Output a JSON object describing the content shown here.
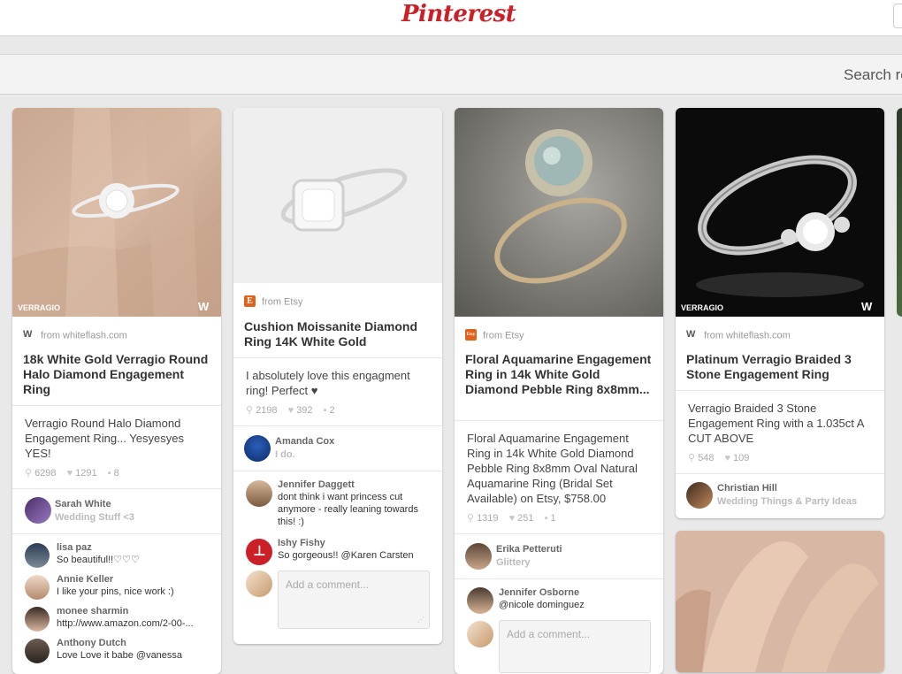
{
  "header": {
    "logo": "Pinterest",
    "search_label": "Search re"
  },
  "colors": {
    "brand": "#cb2027",
    "etsy": "#e1621b"
  },
  "pins": [
    {
      "source_icon": "whiteflash-icon",
      "source": "from whiteflash.com",
      "title": "18k White Gold Verragio Round Halo Diamond Engagement Ring",
      "image_brand": "VERRAGIO",
      "description": "Verragio Round Halo Diamond Engagement Ring... Yesyesyes YES!",
      "repins": "6298",
      "likes": "1291",
      "comments": "8",
      "pinner": "Sarah White",
      "board": "Wedding Stuff <3",
      "comment_list": [
        {
          "name": "lisa paz",
          "text": "So beautiful!!♡♡♡"
        },
        {
          "name": "Annie Keller",
          "text": "I like your pins, nice work :)"
        },
        {
          "name": "monee sharmin",
          "text": "http://www.amazon.com/2-00-..."
        },
        {
          "name": "Anthony Dutch",
          "text": "Love Love it babe @vanessa"
        }
      ]
    },
    {
      "source_icon": "etsy-icon",
      "source_letter": "E",
      "source": "from Etsy",
      "title": "Cushion Moissanite Diamond Ring 14K White Gold",
      "description": "I absolutely love this engagment ring! Perfect ♥",
      "repins": "2198",
      "likes": "392",
      "comments": "2",
      "pinner": "Amanda Cox",
      "board": "I do.",
      "comment_list": [
        {
          "name": "Jennifer Daggett",
          "text": "dont think i want princess cut anymore - really leaning towards this! :)"
        },
        {
          "name": "Ishy Fishy",
          "text": "So gorgeous!! @Karen Carsten"
        }
      ],
      "comment_placeholder": "Add a comment..."
    },
    {
      "source_icon": "etsy-icon",
      "source_letter": "Etsy",
      "source": "from Etsy",
      "title": "Floral Aquamarine Engagement Ring in 14k White Gold Diamond Pebble Ring 8x8mm...",
      "description": "Floral Aquamarine Engagement Ring in 14k White Gold Diamond Pebble Ring 8x8mm Oval Natural Aquamarine Ring (Bridal Set Available) on Etsy, $758.00",
      "repins": "1319",
      "likes": "251",
      "comments": "1",
      "pinner": "Erika Petteruti",
      "board": "Glittery",
      "comment_list": [
        {
          "name": "Jennifer Osborne",
          "text": "@nicole dominguez"
        }
      ],
      "comment_placeholder": "Add a comment..."
    },
    {
      "source_icon": "whiteflash-icon",
      "source": "from whiteflash.com",
      "title": "Platinum Verragio Braided 3 Stone Engagement Ring",
      "image_brand": "VERRAGIO",
      "description": "Verragio Braided 3 Stone Engagement Ring with a 1.035ct A CUT ABOVE",
      "repins": "548",
      "likes": "109",
      "pinner": "Christian Hill",
      "board": "Wedding Things & Party Ideas"
    }
  ]
}
